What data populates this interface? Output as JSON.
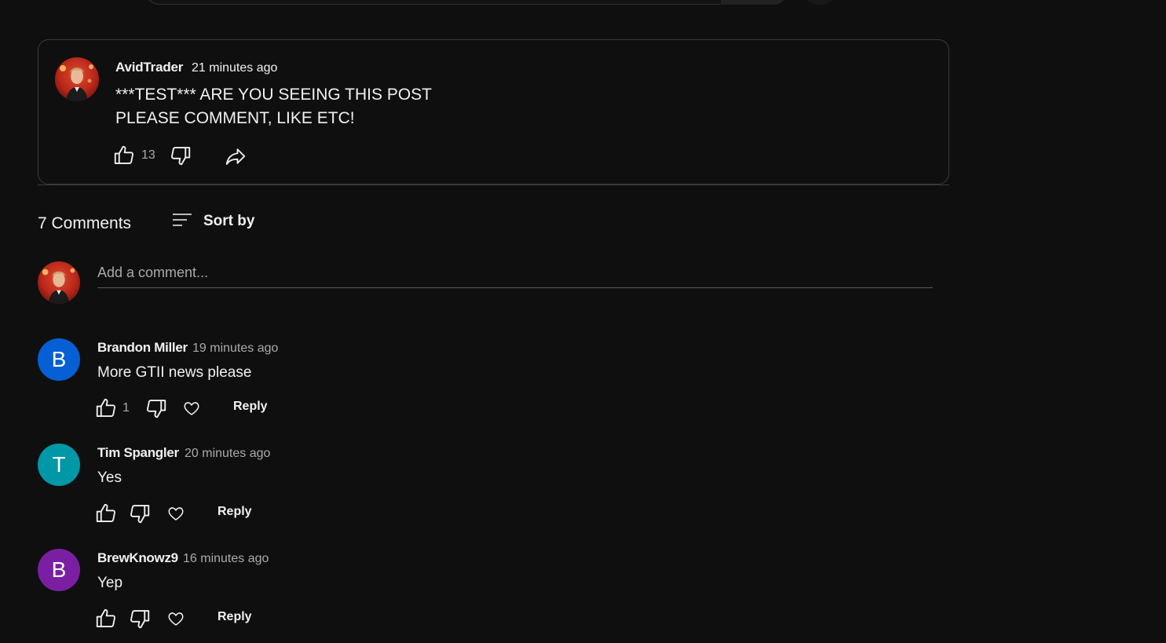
{
  "post": {
    "author": "AvidTrader",
    "time": "21 minutes ago",
    "text_line1": "***TEST*** ARE YOU SEEING THIS POST",
    "text_line2": "PLEASE COMMENT, LIKE ETC!",
    "likes": "13"
  },
  "comments_header": {
    "count_label": "7 Comments",
    "sort_label": "Sort by"
  },
  "add_comment": {
    "placeholder": "Add a comment..."
  },
  "comments": [
    {
      "initial": "B",
      "avatar_color": "#065fd4",
      "author": "Brandon Miller",
      "time": "19 minutes ago",
      "text": "More GTII news please",
      "likes": "1",
      "reply_label": "Reply"
    },
    {
      "initial": "T",
      "avatar_color": "#0097a7",
      "author": "Tim Spangler",
      "time": "20 minutes ago",
      "text": "Yes",
      "likes": "",
      "reply_label": "Reply"
    },
    {
      "initial": "B",
      "avatar_color": "#7b1fa2",
      "author": "BrewKnowz9",
      "time": "16 minutes ago",
      "text": "Yep",
      "likes": "",
      "reply_label": "Reply"
    }
  ]
}
